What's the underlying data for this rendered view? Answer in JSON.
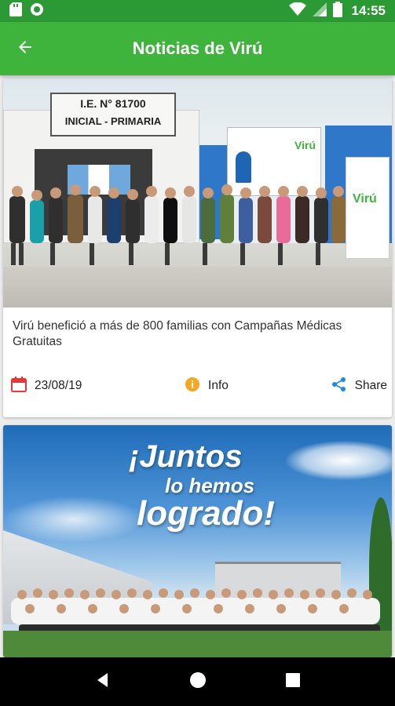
{
  "status_bar": {
    "time": "14:55"
  },
  "app_bar": {
    "title": "Noticias de Virú"
  },
  "news": [
    {
      "sign_line1": "I.E. N° 81700",
      "sign_line2": "INICIAL - PRIMARIA",
      "banner_brand": "Virú",
      "title": "Virú benefició a más de 800 familias con Campañas Médicas Gratuitas",
      "date": "23/08/19",
      "info_label": "Info",
      "share_label": "Share"
    },
    {
      "headline_line1": "¡Juntos",
      "headline_line2": "lo hemos",
      "headline_line3": "logrado!"
    }
  ],
  "colors": {
    "status": "#2c9a34",
    "app_bar": "#3fb43c",
    "calendar": "#e53935",
    "info": "#f5a623",
    "share": "#1e88e5"
  },
  "icons": {
    "back": "arrow-left-icon",
    "calendar": "calendar-icon",
    "info": "info-icon",
    "share": "share-icon"
  }
}
